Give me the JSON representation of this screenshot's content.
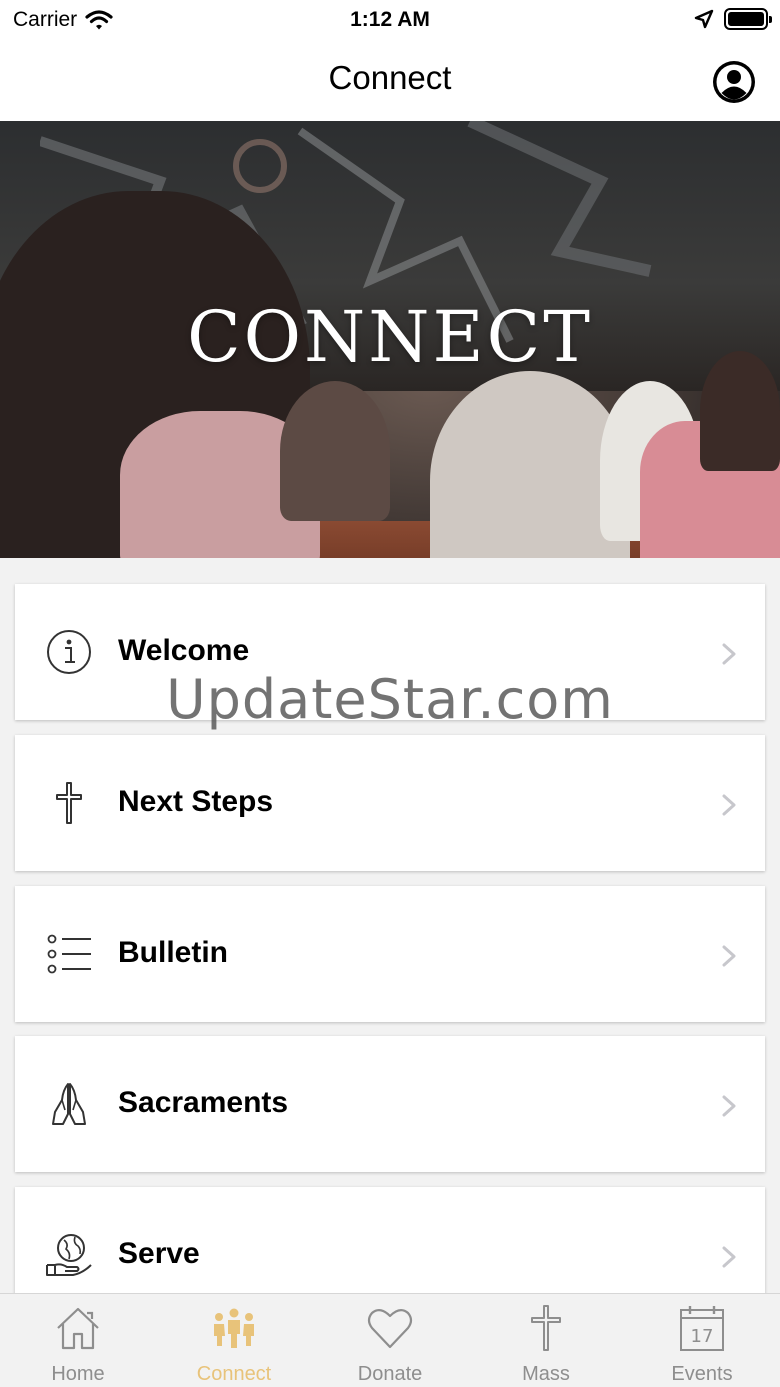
{
  "status_bar": {
    "carrier": "Carrier",
    "time": "1:12 AM"
  },
  "nav": {
    "title": "Connect"
  },
  "hero": {
    "title": "CONNECT"
  },
  "menu": [
    {
      "label": "Welcome",
      "icon": "info-icon"
    },
    {
      "label": "Next Steps",
      "icon": "cross-icon"
    },
    {
      "label": "Bulletin",
      "icon": "list-icon"
    },
    {
      "label": "Sacraments",
      "icon": "praying-hands-icon"
    },
    {
      "label": "Serve",
      "icon": "globe-hand-icon"
    }
  ],
  "watermark": "UpdateStar.com",
  "tabs": [
    {
      "label": "Home",
      "icon": "home-icon",
      "active": false
    },
    {
      "label": "Connect",
      "icon": "people-icon",
      "active": true
    },
    {
      "label": "Donate",
      "icon": "heart-icon",
      "active": false
    },
    {
      "label": "Mass",
      "icon": "cross-icon",
      "active": false
    },
    {
      "label": "Events",
      "icon": "calendar-icon",
      "active": false,
      "day": "17"
    }
  ],
  "colors": {
    "accent": "#e8c37a",
    "inactive": "#8e8e8e"
  }
}
